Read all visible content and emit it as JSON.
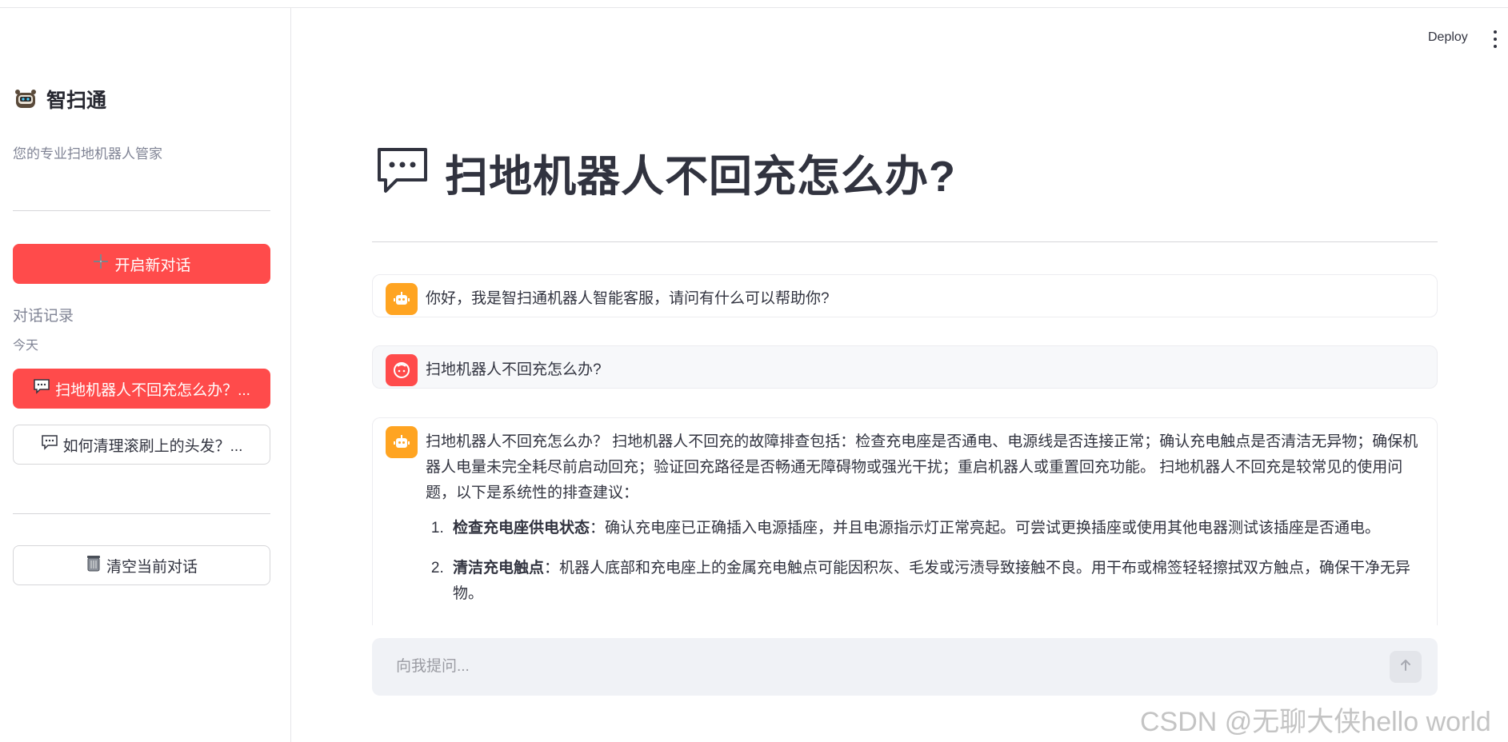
{
  "header": {
    "deploy_label": "Deploy"
  },
  "sidebar": {
    "brand_title": "智扫通",
    "brand_subtitle": "您的专业扫地机器人管家",
    "new_chat_label": "开启新对话",
    "history_label": "对话记录",
    "today_label": "今天",
    "history_items": [
      {
        "label": "扫地机器人不回充怎么办？...",
        "active": true
      },
      {
        "label": "如何清理滚刷上的头发？...",
        "active": false
      }
    ],
    "clear_label": "清空当前对话"
  },
  "main": {
    "title": "扫地机器人不回充怎么办?",
    "messages": [
      {
        "role": "bot",
        "text": "你好，我是智扫通机器人智能客服，请问有什么可以帮助你?"
      },
      {
        "role": "user",
        "text": "扫地机器人不回充怎么办?"
      },
      {
        "role": "bot",
        "text": "扫地机器人不回充怎么办？ 扫地机器人不回充的故障排查包括：检查充电座是否通电、电源线是否连接正常；确认充电触点是否清洁无异物；确保机器人电量未完全耗尽前启动回充；验证回充路径是否畅通无障碍物或强光干扰；重启机器人或重置回充功能。 扫地机器人不回充是较常见的使用问题，以下是系统性的排查建议：",
        "list": [
          {
            "title": "检查充电座供电状态",
            "body": "：确认充电座已正确插入电源插座，并且电源指示灯正常亮起。可尝试更换插座或使用其他电器测试该插座是否通电。"
          },
          {
            "title": "清洁充电触点",
            "body": "：机器人底部和充电座上的金属充电触点可能因积灰、毛发或污渍导致接触不良。用干布或棉签轻轻擦拭双方触点，确保干净无异物。"
          }
        ]
      }
    ],
    "input_placeholder": "向我提问..."
  },
  "watermark": "CSDN @无聊大侠hello world",
  "colors": {
    "primary": "#ff4b4b",
    "bot_avatar": "#ffa421",
    "input_bg": "#f0f2f6"
  }
}
